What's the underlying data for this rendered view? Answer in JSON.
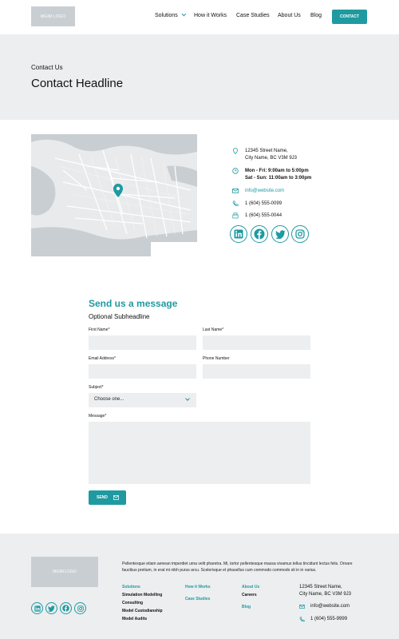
{
  "header": {
    "logo_text": "MGIM LOGO",
    "nav": [
      "Solutions",
      "How it Works",
      "Case Studies",
      "About Us",
      "Blog"
    ],
    "contact_button": "CONTACT"
  },
  "hero": {
    "eyebrow": "Contact Us",
    "headline": "Contact Headline"
  },
  "contact_info": {
    "address_line1": "12345 Street Name,",
    "address_line2": "City Name, BC  V3M 9J3",
    "hours_line1": "Mon - Fri:  9:00am to 5:00pm",
    "hours_line2": "Sat - Sun:  11:00am to 3:00pm",
    "email": "info@website.com",
    "phone": "1 (604) 555-0099",
    "fax": "1 (604) 555-0044"
  },
  "socials": [
    "linkedin-icon",
    "facebook-icon",
    "twitter-icon",
    "instagram-icon"
  ],
  "form": {
    "title": "Send us a message",
    "subheadline": "Optional Subheadline",
    "first_name_label": "First Name*",
    "last_name_label": "Last Name*",
    "email_label": "Email Address*",
    "phone_label": "Phone Number",
    "subject_label": "Subject*",
    "subject_value": "Choose one...",
    "message_label": "Message*",
    "send_label": "SEND"
  },
  "footer": {
    "logo_text": "MGIM LOGO",
    "paragraph": "Pellentesque etiam aenean imperdiet urna velit pharetra. Mi, tortor pellentesque massa vivamus tellus tincidunt lectus felis. Ornare faucibus pretium, in erat mi nibh purus arcu. Scelerisque et phasellus cum commodo commodo sit in in varius.",
    "col1": {
      "heading": "Solutions",
      "items": [
        "Simulation Modelling Consulting",
        "Model Custodianship",
        "Model Audits"
      ]
    },
    "col2": {
      "items": [
        "How it Works",
        "Case Studies"
      ]
    },
    "col3": {
      "heading": "About Us",
      "items": [
        "Careers"
      ],
      "blog": "Blog"
    },
    "address_line1": "12345 Street Name,",
    "address_line2": "City Name, BC  V3M 9J3",
    "email": "info@website.com",
    "phone": "1 (604) 555-9999"
  },
  "colors": {
    "accent": "#1e9aa0",
    "band": "#eceef0",
    "placeholder_logo": "#c9ced3"
  }
}
